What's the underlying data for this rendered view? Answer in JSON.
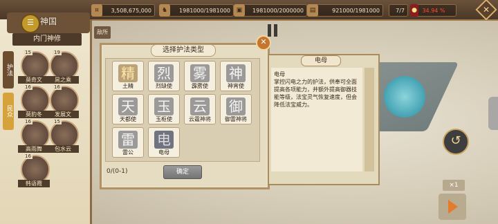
{
  "topbar": {
    "resources": [
      {
        "icon": "coin-icon",
        "value": "3,508,675,000"
      },
      {
        "icon": "troops-icon",
        "value": "1981000/1981000"
      },
      {
        "icon": "food-icon",
        "value": "1981000/2000000"
      },
      {
        "icon": "wood-icon",
        "value": "921000/1981000"
      },
      {
        "icon": "slots-icon",
        "value": "7/7"
      },
      {
        "icon": "power-icon",
        "value": "34.94 %"
      }
    ]
  },
  "left_panel": {
    "title": "神国",
    "subtitle": "内门神修",
    "tabs": [
      "护法",
      "民众"
    ],
    "heroes": [
      {
        "level": "15",
        "name": "莫奇文"
      },
      {
        "level": "19",
        "name": "晁之乘"
      },
      {
        "level": "16",
        "name": "莫豹冬"
      },
      {
        "level": "16",
        "name": "发展文"
      },
      {
        "level": "16",
        "name": "高雨舞"
      },
      {
        "level": "15",
        "name": "包水云"
      },
      {
        "level": "16",
        "name": "韩语霞"
      }
    ]
  },
  "flag_label": "敌所",
  "dialog": {
    "title": "选择护法类型",
    "types": [
      {
        "glyph": "精",
        "name": "土精",
        "style": "gold"
      },
      {
        "glyph": "烈",
        "name": "烈缺使",
        "style": "normal"
      },
      {
        "glyph": "雾",
        "name": "霹雳使",
        "style": "normal"
      },
      {
        "glyph": "神",
        "name": "神宵使",
        "style": "normal"
      },
      {
        "glyph": "天",
        "name": "天都使",
        "style": "normal"
      },
      {
        "glyph": "玉",
        "name": "玉枢使",
        "style": "normal"
      },
      {
        "glyph": "云",
        "name": "云霆神将",
        "style": "normal"
      },
      {
        "glyph": "御",
        "name": "御雷神将",
        "style": "normal"
      },
      {
        "glyph": "雷",
        "name": "雷公",
        "style": "normal"
      },
      {
        "glyph": "电",
        "name": "电母",
        "style": "dark"
      }
    ],
    "count": "0/(0-1)",
    "confirm": "确定"
  },
  "info": {
    "title": "电母",
    "name": "电母",
    "desc": "掌控闪电之力的护法，供奉可全面提高各项能力，并额外提高御器技能等级，法宝灵气恢复速度，但会降低法宝威力。"
  },
  "speed": "×1"
}
